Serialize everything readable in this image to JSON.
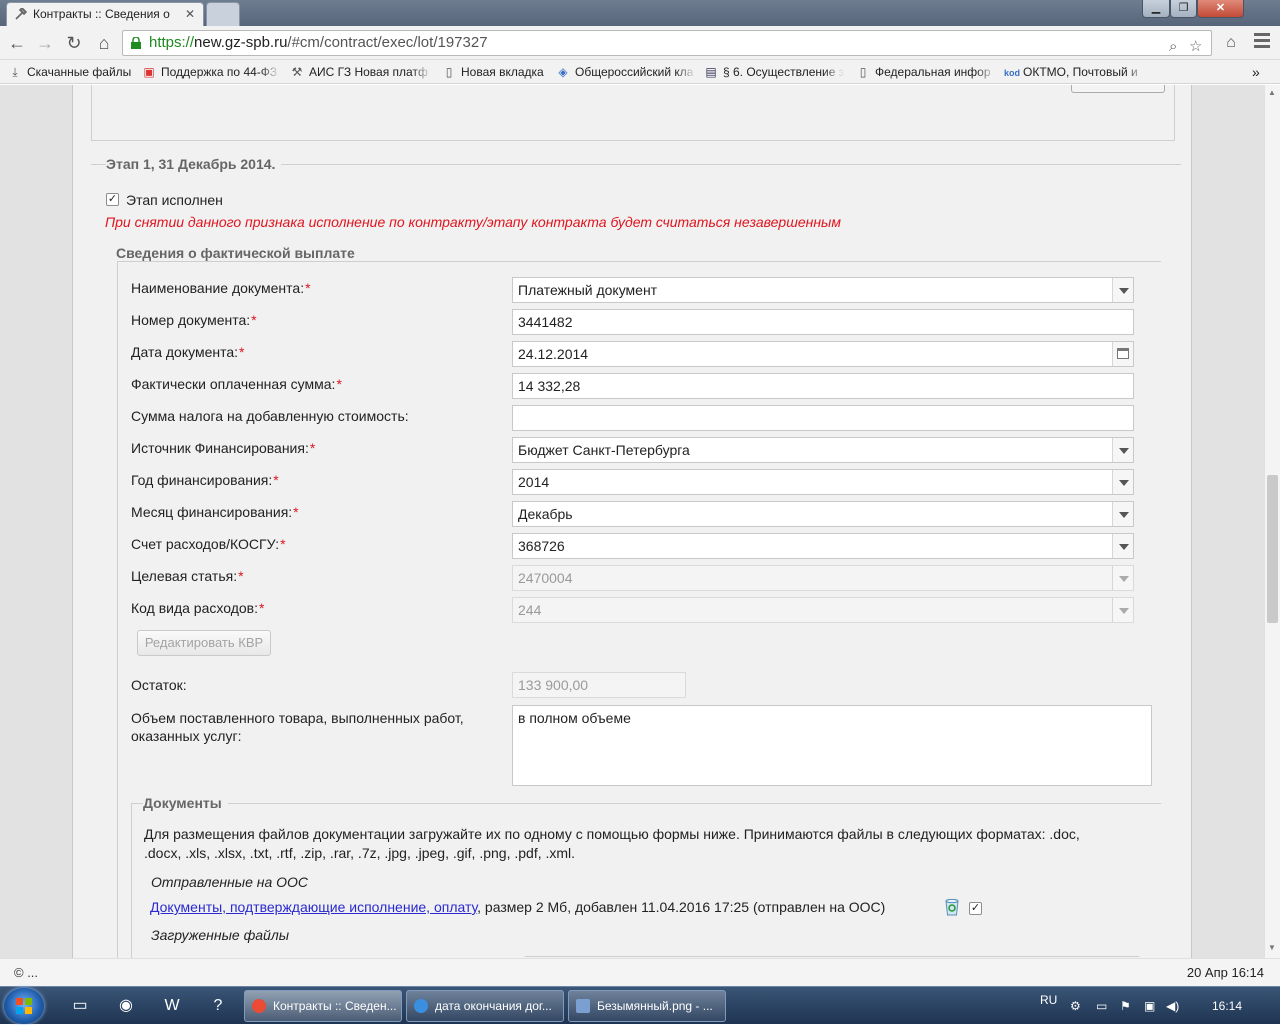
{
  "browser": {
    "tab_title": "Контракты :: Сведения о",
    "url_scheme": "https://",
    "url_host": "new.gz-spb.ru",
    "url_path": "/#cm/contract/exec/lot/197327",
    "bookmarks": [
      {
        "label": "Скачанные файлы",
        "icon": "download-icon"
      },
      {
        "label": "Поддержка по 44-ФЗ",
        "icon": "support-icon"
      },
      {
        "label": "АИС ГЗ Новая платф",
        "icon": "tools-icon"
      },
      {
        "label": "Новая вкладка",
        "icon": "page-icon"
      },
      {
        "label": "Общероссийский кла",
        "icon": "globe-icon"
      },
      {
        "label": "§ 6. Осуществление з",
        "icon": "book-icon"
      },
      {
        "label": "Федеральная инфор",
        "icon": "page-icon"
      },
      {
        "label": "ОКТМО, Почтовый и",
        "icon": "kod-icon"
      }
    ]
  },
  "stage": {
    "legend": "Этап 1, 31 Декабрь 2014.",
    "completed_label": "Этап исполнен",
    "completed_checked": true,
    "warning": "При снятии данного признака исполнение по контракту/этапу контракта будет считаться незавершенным"
  },
  "payment": {
    "legend": "Сведения о фактической выплате",
    "fields": [
      {
        "label": "Наименование документа:",
        "required": true,
        "value": "Платежный документ",
        "kind": "select",
        "disabled": false
      },
      {
        "label": "Номер документа:",
        "required": true,
        "value": "3441482",
        "kind": "text",
        "disabled": false
      },
      {
        "label": "Дата документа:",
        "required": true,
        "value": "24.12.2014",
        "kind": "date",
        "disabled": false
      },
      {
        "label": "Фактически оплаченная сумма:",
        "required": true,
        "value": "14 332,28",
        "kind": "text",
        "disabled": false
      },
      {
        "label": "Сумма налога на добавленную стоимость:",
        "required": false,
        "value": "",
        "kind": "text",
        "disabled": false
      },
      {
        "label": "Источник Финансирования:",
        "required": true,
        "value": "Бюджет Санкт-Петербурга",
        "kind": "select",
        "disabled": false
      },
      {
        "label": "Год финансирования:",
        "required": true,
        "value": "2014",
        "kind": "select",
        "disabled": false
      },
      {
        "label": "Месяц финансирования:",
        "required": true,
        "value": "Декабрь",
        "kind": "select",
        "disabled": false
      },
      {
        "label": "Счет расходов/КОСГУ:",
        "required": true,
        "value": "368726",
        "kind": "select",
        "disabled": false
      },
      {
        "label": "Целевая статья:",
        "required": true,
        "value": "2470004",
        "kind": "select",
        "disabled": true
      },
      {
        "label": "Код вида расходов:",
        "required": true,
        "value": "244",
        "kind": "select",
        "disabled": true
      }
    ],
    "edit_kvr_label": "Редактировать КВР",
    "remainder_label": "Остаток:",
    "remainder_value": "133 900,00",
    "volume_label_line1": "Объем поставленного товара, выполненных работ,",
    "volume_label_line2": "оказанных услуг:",
    "volume_value": "в полном объеме"
  },
  "documents": {
    "legend": "Документы",
    "info_line1": "Для размещения файлов документации загружайте их по одному с помощью формы ниже. Принимаются файлы в следующих форматах: .doc,",
    "info_line2": ".docx, .xls, .xlsx, .txt, .rtf, .zip, .rar, .7z, .jpg, .jpeg, .gif, .png, .pdf, .xml.",
    "sent_heading": "Отправленные на ООС",
    "sent_link": "Документы, подтверждающие исполнение, оплату",
    "sent_details": ", размер 2 Мб, добавлен 11.04.2016 17:25 (отправлен на ООС)",
    "uploaded_heading": "Загруженные файлы"
  },
  "statusbar": {
    "left": "© ...",
    "right": "20 Апр 16:14"
  },
  "taskbar": {
    "tasks": [
      {
        "label": "Контракты :: Сведен...",
        "icon_color": "#e94b35"
      },
      {
        "label": "дата окончания дог...",
        "icon_color": "#3b8fe0"
      },
      {
        "label": "Безымянный.png - ...",
        "icon_color": "#7b9fd0"
      }
    ],
    "lang": "RU",
    "clock": "16:14"
  }
}
